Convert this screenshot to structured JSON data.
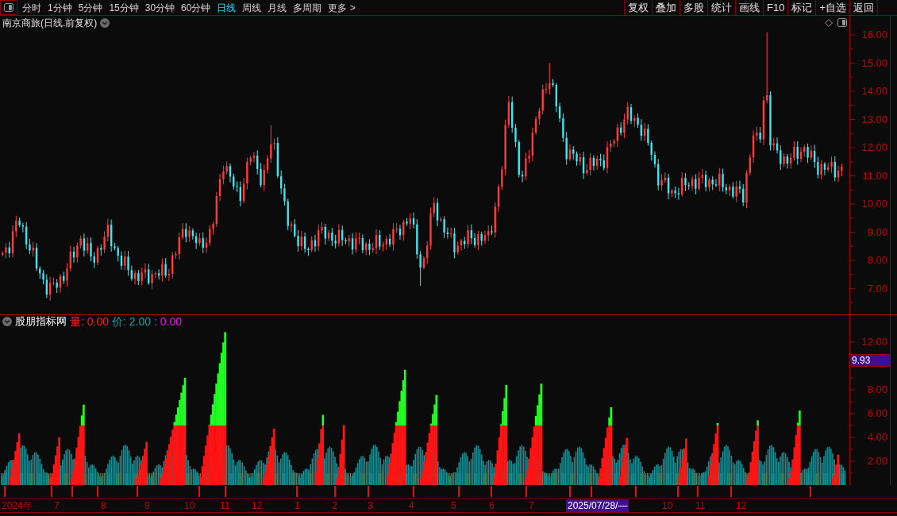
{
  "toolbar": {
    "periods": [
      {
        "label": "分时",
        "selected": false
      },
      {
        "label": "1分钟",
        "selected": false
      },
      {
        "label": "5分钟",
        "selected": false
      },
      {
        "label": "15分钟",
        "selected": false
      },
      {
        "label": "30分钟",
        "selected": false
      },
      {
        "label": "60分钟",
        "selected": false
      },
      {
        "label": "日线",
        "selected": true
      },
      {
        "label": "周线",
        "selected": false
      },
      {
        "label": "月线",
        "selected": false
      },
      {
        "label": "多周期",
        "selected": false
      },
      {
        "label": "更多 >",
        "selected": false
      }
    ],
    "buttons": [
      "复权",
      "叠加",
      "多股",
      "统计",
      "画线",
      "F10",
      "标记",
      "+自选",
      "返回"
    ]
  },
  "price_chart": {
    "title": "南京商旅(日线.前复权)",
    "price_axis": [
      "16.00",
      "15.00",
      "14.00",
      "13.00",
      "12.00",
      "11.00",
      "10.00",
      "9.00",
      "8.00",
      "7.00"
    ]
  },
  "indicator_panel": {
    "name": "股朋指标网",
    "readings": [
      {
        "text": "量: 0.00",
        "color": "#ff1a1a"
      },
      {
        "text": "价: 2.00",
        "color": "#189c9c"
      },
      {
        "text": ": 0.00",
        "color": "#ff00ff"
      }
    ],
    "value_axis": [
      {
        "kind": "tick",
        "label": "12.00"
      },
      {
        "kind": "marker",
        "label": "9.93"
      },
      {
        "kind": "tick",
        "label": "8.00"
      },
      {
        "kind": "tick",
        "label": "6.00"
      },
      {
        "kind": "tick",
        "label": "4.00"
      },
      {
        "kind": "tick",
        "label": "2.00"
      }
    ]
  },
  "time_axis": [
    {
      "kind": "tick",
      "label": "2024年"
    },
    {
      "kind": "tick",
      "label": "7"
    },
    {
      "kind": "tick",
      "label": "8"
    },
    {
      "kind": "tick",
      "label": "9"
    },
    {
      "kind": "tick",
      "label": "10"
    },
    {
      "kind": "tick",
      "label": "11"
    },
    {
      "kind": "tick",
      "label": "12"
    },
    {
      "kind": "tick",
      "label": "1"
    },
    {
      "kind": "tick",
      "label": "2"
    },
    {
      "kind": "tick",
      "label": "3"
    },
    {
      "kind": "tick",
      "label": "4"
    },
    {
      "kind": "tick",
      "label": "5"
    },
    {
      "kind": "tick",
      "label": "6"
    },
    {
      "kind": "tick",
      "label": "7"
    },
    {
      "kind": "cursor",
      "label": "2025/07/28/—"
    },
    {
      "kind": "tick",
      "label": "10"
    },
    {
      "kind": "tick",
      "label": "11"
    },
    {
      "kind": "tick",
      "label": "12"
    }
  ]
}
